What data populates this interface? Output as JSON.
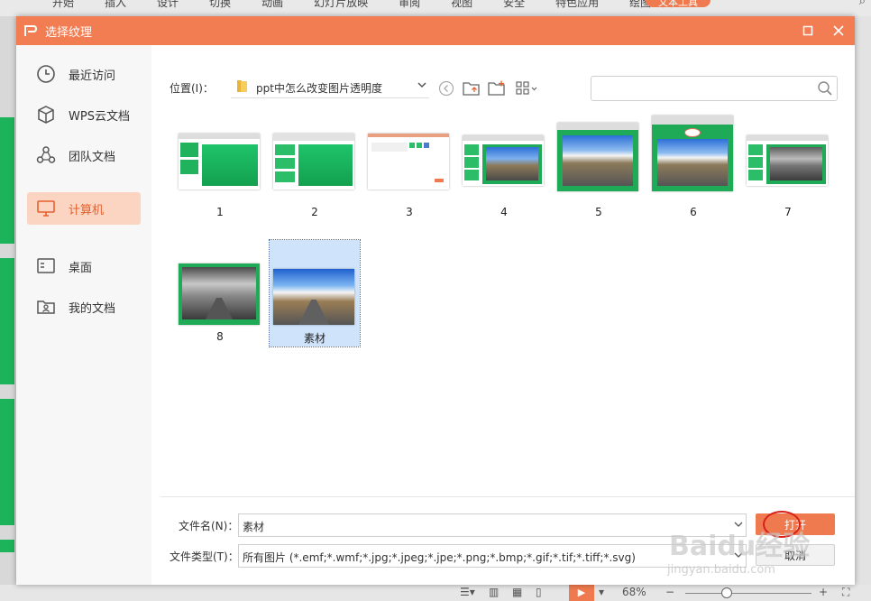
{
  "app": {
    "menu": [
      "开始",
      "插入",
      "设计",
      "切换",
      "动画",
      "幻灯片放映",
      "审阅",
      "视图",
      "安全",
      "特色应用",
      "绘图工具"
    ],
    "pill_label": "文本工具",
    "zoom": "68%"
  },
  "dialog": {
    "title": "选择纹理",
    "sidebar": [
      {
        "label": "最近访问",
        "icon": "clock-icon"
      },
      {
        "label": "WPS云文档",
        "icon": "cube-icon"
      },
      {
        "label": "团队文档",
        "icon": "team-icon"
      },
      {
        "label": "计算机",
        "icon": "computer-icon",
        "active": true
      },
      {
        "label": "桌面",
        "icon": "desktop-icon"
      },
      {
        "label": "我的文档",
        "icon": "my-documents-icon"
      }
    ],
    "location": {
      "label": "位置(I)：",
      "value": "ppt中怎么改变图片透明度"
    },
    "search": {
      "placeholder": ""
    },
    "files": [
      {
        "name": "1"
      },
      {
        "name": "2"
      },
      {
        "name": "3"
      },
      {
        "name": "4"
      },
      {
        "name": "5"
      },
      {
        "name": "6"
      },
      {
        "name": "7"
      },
      {
        "name": "8"
      },
      {
        "name": "素材",
        "selected": true
      }
    ],
    "filename": {
      "label": "文件名(N)：",
      "value": "素材"
    },
    "filetype": {
      "label": "文件类型(T)：",
      "value": "所有图片 (*.emf;*.wmf;*.jpg;*.jpeg;*.jpe;*.png;*.bmp;*.gif;*.tif;*.tiff;*.svg)"
    },
    "buttons": {
      "open": "打开",
      "cancel": "取消"
    },
    "colors": {
      "accent": "#f37d53",
      "active_bg": "#fbd5c1",
      "selected_bg": "#cfe3fb"
    }
  },
  "watermark": {
    "brand": "Baidu经验",
    "url": "jingyan.baidu.com"
  }
}
